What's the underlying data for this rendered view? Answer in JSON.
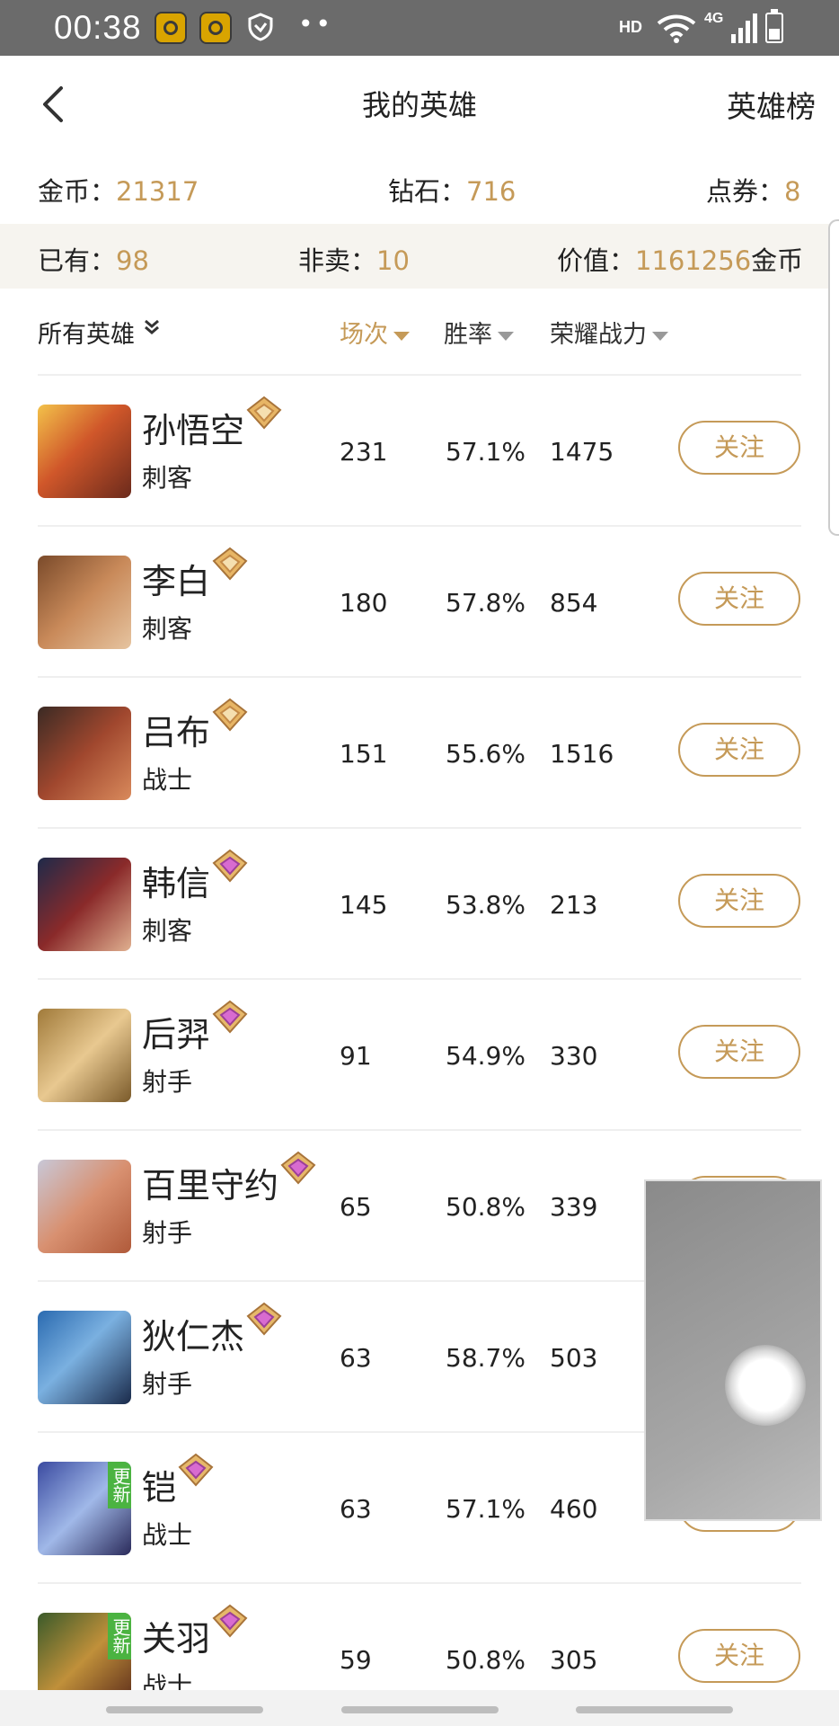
{
  "status_bar": {
    "time": "00:38",
    "hd": "HD",
    "network": "4G"
  },
  "header": {
    "title": "我的英雄",
    "right_label": "英雄榜"
  },
  "stats": {
    "coins_label": "金币：",
    "coins": "21317",
    "diamonds_label": "钻石：",
    "diamonds": "716",
    "coupons_label": "点券：",
    "coupons": "8",
    "owned_label": "已有：",
    "owned": "98",
    "not_for_sale_label": "非卖：",
    "not_for_sale": "10",
    "value_label": "价值：",
    "value": "1161256",
    "value_unit": "金币"
  },
  "table_header": {
    "filter": "所有英雄",
    "matches": "场次",
    "win_rate": "胜率",
    "glory_power": "荣耀战力"
  },
  "follow_label": "关注",
  "heroes": [
    {
      "name": "孙悟空",
      "role": "刺客",
      "matches": "231",
      "win_rate": "57.1%",
      "power": "1475"
    },
    {
      "name": "李白",
      "role": "刺客",
      "matches": "180",
      "win_rate": "57.8%",
      "power": "854"
    },
    {
      "name": "吕布",
      "role": "战士",
      "matches": "151",
      "win_rate": "55.6%",
      "power": "1516"
    },
    {
      "name": "韩信",
      "role": "刺客",
      "matches": "145",
      "win_rate": "53.8%",
      "power": "213"
    },
    {
      "name": "后羿",
      "role": "射手",
      "matches": "91",
      "win_rate": "54.9%",
      "power": "330"
    },
    {
      "name": "百里守约",
      "role": "射手",
      "matches": "65",
      "win_rate": "50.8%",
      "power": "339"
    },
    {
      "name": "狄仁杰",
      "role": "射手",
      "matches": "63",
      "win_rate": "58.7%",
      "power": "503"
    },
    {
      "name": "铠",
      "role": "战士",
      "matches": "63",
      "win_rate": "57.1%",
      "power": "460",
      "tag": "更新"
    },
    {
      "name": "关羽",
      "role": "战士",
      "matches": "59",
      "win_rate": "50.8%",
      "power": "305",
      "tag": "更新"
    }
  ],
  "colors": {
    "accent": "#c59a58",
    "status_bar": "#6b6b6b",
    "stats_band": "#f6f4ef",
    "new_tag": "#4bb341"
  }
}
